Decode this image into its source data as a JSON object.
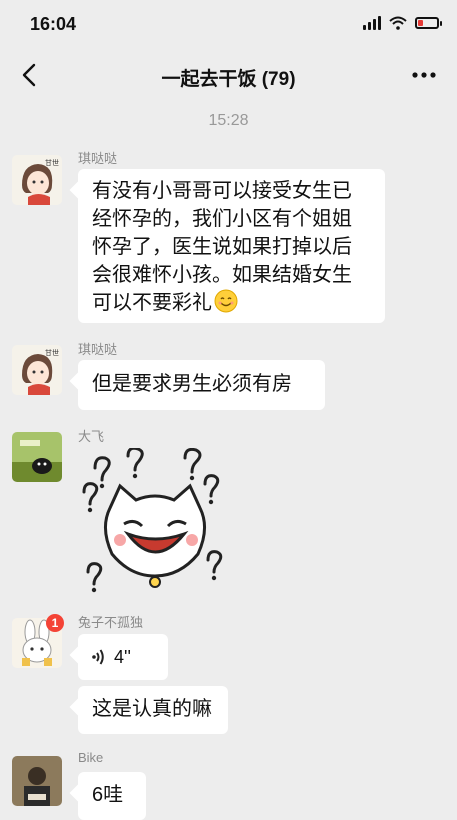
{
  "status": {
    "time": "16:04"
  },
  "nav": {
    "title": "一起去干饭 (79)"
  },
  "chat": {
    "timestamp": "15:28",
    "messages": [
      {
        "sender": "琪哒哒",
        "text": "有没有小哥哥可以接受女生已\n经怀孕的，我们小区有个姐姐\n怀孕了，医生说如果打掉以后\n会很难怀小孩。如果结婚女生\n可以不要彩礼"
      },
      {
        "sender": "琪哒哒",
        "text": "但是要求男生必须有房"
      },
      {
        "sender": "大飞",
        "sticker": "question-marks-laughing-cat-sticker"
      },
      {
        "sender": "兔子不孤独",
        "badge": "1",
        "voice_duration": "4''"
      },
      {
        "text": "这是认真的嘛"
      },
      {
        "sender": "Bike",
        "text": "6哇"
      }
    ]
  },
  "colors": {
    "background": "#ededed",
    "bubble": "#ffffff",
    "badge": "#f44336"
  }
}
